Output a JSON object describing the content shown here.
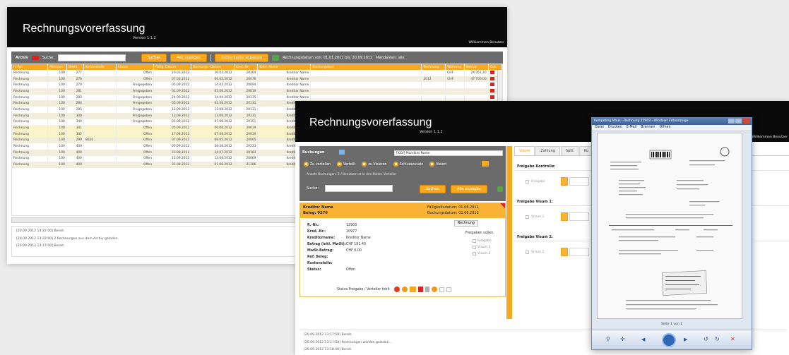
{
  "colors": {
    "header": "#0a0a0a",
    "toolbar": "#6b6b6b",
    "accent": "#f7a823",
    "row_alt": "#f2eedd",
    "row_hl": "#fbf3c9"
  },
  "win1": {
    "app_title": "Rechnungsvorerfassung",
    "version": "Version 1.1.2",
    "welcome": "Willkommen Benutzer",
    "toolbar": {
      "archiv_label": "Archiv",
      "search_label": "Suche:",
      "search_value": "",
      "search_button": "Suchen",
      "show_all_button": "Alle anzeigen",
      "archive_button": "Archiv-Suche anpassen",
      "period_text": "Rechnungsdatum von: 01.01.2012  bis: 20.09.2012",
      "mandant_text": "Mandanten: alle"
    },
    "table": {
      "headers": [
        "R.-Typ",
        "Mandant",
        "Beleg.",
        "Kostenstelle",
        "Status",
        "Fällig. Datum",
        "Buchungs.-Datum",
        "Kred.-Nr.",
        "Kred.-Name",
        "Buchungstext",
        "Rechnung",
        "Währung",
        "Betrag",
        "Dok."
      ],
      "rows": [
        [
          "Rechnung",
          "100",
          "277",
          "",
          "Offen",
          "20.03.2012",
          "20.02.2012",
          "20304",
          "Kreditor Name",
          "",
          "",
          "CHF",
          "24'351.20"
        ],
        [
          "Rechnung",
          "100",
          "276",
          "",
          "Offen",
          "07.03.2012",
          "06.02.2012",
          "20076",
          "Kreditor Name",
          "",
          "2012",
          "CHF",
          "47'700.00"
        ],
        [
          "Rechnung",
          "100",
          "270",
          "",
          "Freigegeben",
          "05.09.2012",
          "14.02.2012",
          "20094",
          "Kreditor Name",
          "",
          "",
          "",
          ""
        ],
        [
          "Rechnung",
          "100",
          "281",
          "",
          "Freigegeben",
          "01.09.2012",
          "02.08.2012",
          "20019",
          "Kreditor Name",
          "",
          "",
          "",
          ""
        ],
        [
          "Rechnung",
          "100",
          "283",
          "",
          "Freigegeben",
          "24.09.2012",
          "24.04.2012",
          "20135",
          "Kreditor Name",
          "",
          "",
          "",
          ""
        ],
        [
          "Rechnung",
          "100",
          "284",
          "",
          "Freigegeben",
          "05.09.2012",
          "02.08.2012",
          "20131",
          "Kreditor Name",
          "",
          "",
          "",
          ""
        ],
        [
          "Rechnung",
          "100",
          "285",
          "",
          "Freigegeben",
          "12.09.2012",
          "13.08.2012",
          "20131",
          "Kreditor Name",
          "",
          "",
          "",
          ""
        ],
        [
          "Rechnung",
          "100",
          "300",
          "",
          "Freigegeben",
          "12.09.2012",
          "13.08.2012",
          "20131",
          "Kreditor Name",
          "",
          "",
          "",
          ""
        ],
        [
          "Rechnung",
          "100",
          "340",
          "",
          "Freigegeben",
          "05.09.2012",
          "07.08.2012",
          "20351",
          "Kreditor Name",
          "",
          "",
          "",
          ""
        ],
        [
          "Rechnung",
          "100",
          "341",
          "",
          "Offen",
          "05.09.2012",
          "06.08.2012",
          "20019",
          "Kreditor Name",
          "",
          "",
          "",
          ""
        ],
        [
          "Rechnung",
          "100",
          "342",
          "",
          "Offen",
          "17.08.2012",
          "07.08.2012",
          "20019",
          "Kreditor Name",
          "",
          "",
          "",
          ""
        ],
        [
          "Rechnung",
          "100",
          "299",
          "8620",
          "Offen",
          "07.09.2012",
          "08.05.2012",
          "20065",
          "Kreditor Name",
          "",
          "",
          "",
          ""
        ],
        [
          "Rechnung",
          "100",
          "400",
          "",
          "Offen",
          "05.09.2012",
          "08.08.2012",
          "20333",
          "Kreditor Name",
          "",
          "",
          "",
          ""
        ],
        [
          "Rechnung",
          "100",
          "400",
          "",
          "Offen",
          "23.08.2012",
          "24.07.2012",
          "20183",
          "Kreditor Name",
          "",
          "",
          "",
          ""
        ],
        [
          "Rechnung",
          "100",
          "400",
          "",
          "Offen",
          "12.09.2012",
          "13.08.2012",
          "20069",
          "Kreditor Name",
          "",
          "",
          "",
          ""
        ],
        [
          "Rechnung",
          "100",
          "400",
          "",
          "Offen",
          "31.08.2012",
          "01.08.2012",
          "21166",
          "Kreditor Name",
          "",
          "",
          "",
          ""
        ]
      ]
    },
    "log": [
      "[20.09.2012 13:22:00] Bereit.",
      "[20.09.2012 13:22:00] 2 Rechnungen aus dem Archiv geladen.",
      "[20.09.2012 13:17:00] Bereit."
    ]
  },
  "win2": {
    "app_title": "Rechnungsvorerfassung",
    "version": "Version 1.1.2",
    "welcome": "Willkommen Benutzer",
    "buchungen_label": "Buchungen",
    "mandant_select": "[XXX] Mandant Name",
    "filters": [
      "Zu verteilen",
      "Verteilt",
      "zu Visieren",
      "Schlusszusatz",
      "Visiert"
    ],
    "info_text": "Anzahl Buchungen: 2 / Benutzer ist in den Rollen Verteiler",
    "search_label": "Suche:",
    "search_value": "",
    "search_button": "Suchen",
    "show_all_button": "Alle anzeigen",
    "card": {
      "title1": "Kreditor Name",
      "title2": "Beleg: 0270",
      "due": "Fälligkeitsdatum: 01.08.2012",
      "booked": "Buchungsdatum: 01.08.2012",
      "type_button": "Rechnung",
      "fields": [
        {
          "k": "R.-Nr.:",
          "v": "12903"
        },
        {
          "k": "Kred.-Nr.:",
          "v": "20977"
        },
        {
          "k": "Kreditorname:",
          "v": "Kreditor Name"
        },
        {
          "k": "Betrag (inkl. MwSt):",
          "v": "CHF 191.40"
        },
        {
          "k": "MwSt-Betrag:",
          "v": "CHF 0.00"
        },
        {
          "k": "Ref. Beleg:",
          "v": ""
        },
        {
          "k": "Kostenstelle:",
          "v": ""
        },
        {
          "k": "Status:",
          "v": "Offen"
        }
      ],
      "freigabe_title": "Freigaben sollen:",
      "freigaben": [
        "Freigabe",
        "Visum 1",
        "Visum 2"
      ],
      "status_text": "Status Freigabe / Verteiler fehlt"
    },
    "tabs": [
      "Visum",
      "Zahlung",
      "Split",
      "Ko"
    ],
    "sections": [
      {
        "title": "Freigabe Kontrolle:",
        "check": "Freigabe"
      },
      {
        "title": "Freigabe Visum 1:",
        "check": "Visum 1"
      },
      {
        "title": "Freigabe Visum 2:",
        "check": "Visum 2"
      }
    ],
    "log": [
      "[20.09.2012 13:17:58] Bereit.",
      "[20.09.2012 13:17:58] Rechnungen werden geladen...",
      "[20.09.2012 13:18:00] Bereit."
    ]
  },
  "viewer": {
    "title": "Kompeting Maus - Rechnung 12903 - Windows Fotoanzeige",
    "menu": [
      "Datei",
      "Drucken",
      "E-Mail",
      "Brennen",
      "Öffnen"
    ],
    "page_indicator": "Seite 1 von 1"
  }
}
